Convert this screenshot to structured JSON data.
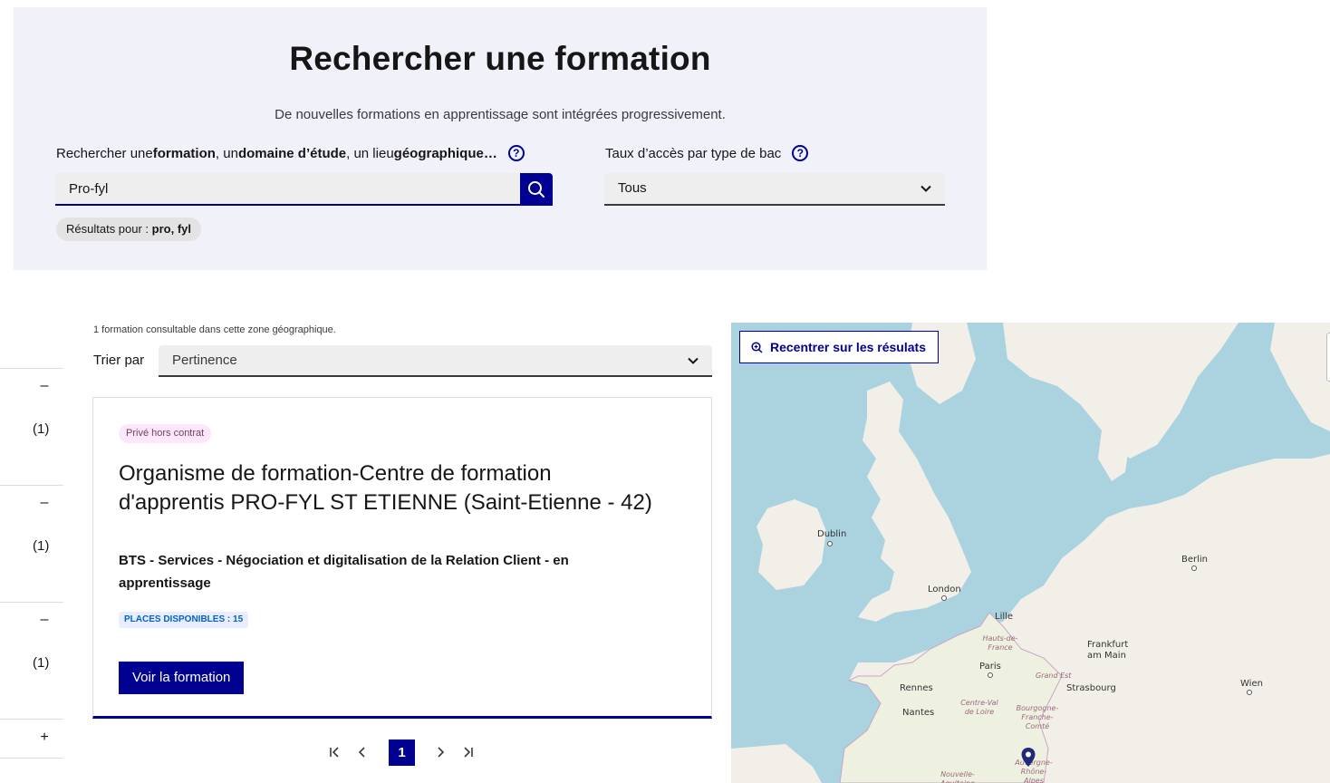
{
  "search": {
    "title": "Rechercher une formation",
    "subtitle": "De nouvelles formations en apprentissage sont intégrées progressivement.",
    "label_prefix": "Rechercher une ",
    "label_formation": "formation",
    "label_sep1": ", un ",
    "label_domaine": "domaine d’étude",
    "label_sep2": ", un lieu ",
    "label_lieu": "géographique…",
    "input_value": "Pro-fyl",
    "results_prefix": "Résultats pour : ",
    "results_terms": "pro, fyl",
    "bac_label": "Taux d’accès par type de bac",
    "bac_value": "Tous",
    "help_glyph": "?"
  },
  "filters": {
    "toggles": [
      "–",
      "–",
      "–",
      "+"
    ],
    "counts": [
      "(1)",
      "(1)",
      "(1)"
    ]
  },
  "results": {
    "count_text": "1 formation consultable dans cette zone géographique.",
    "sort_label": "Trier par",
    "sort_value": "Pertinence"
  },
  "card": {
    "badge": "Privé hors contrat",
    "title": "Organisme de formation-Centre de formation d'apprentis PRO-FYL ST ETIENNE (Saint-Etienne - 42)",
    "subtitle": "BTS - Services - Négociation et digitalisation de la Relation Client - en apprentissage",
    "places": "PLACES DISPONIBLES : 15",
    "cta": "Voir la formation"
  },
  "pagination": {
    "first": "|‹",
    "prev": "‹",
    "current": "1",
    "next": "›",
    "last": "›|"
  },
  "map": {
    "recenter_label": "Recentrer sur les résulats",
    "cities": [
      "Dublin",
      "London",
      "Berlin",
      "Lille",
      "Paris",
      "Frankfurt am Main",
      "Rennes",
      "Strasbourg",
      "Nantes",
      "Wien"
    ],
    "regions": [
      "Hauts-de-France",
      "Grand Est",
      "Centre-Val de Loire",
      "Bourgogne-Franche-Comté",
      "Auvergne-Rhône-Alpes",
      "Nouvelle-Aquitaine"
    ],
    "colors": {
      "sea": "#aad3df",
      "land": "#f2efe9",
      "france": "#eef0e0",
      "marker": "#1f2a7a"
    }
  },
  "theme": {
    "primary": "#000091",
    "panel_bg": "#f1f1fa",
    "input_bg": "#eeeeee"
  }
}
